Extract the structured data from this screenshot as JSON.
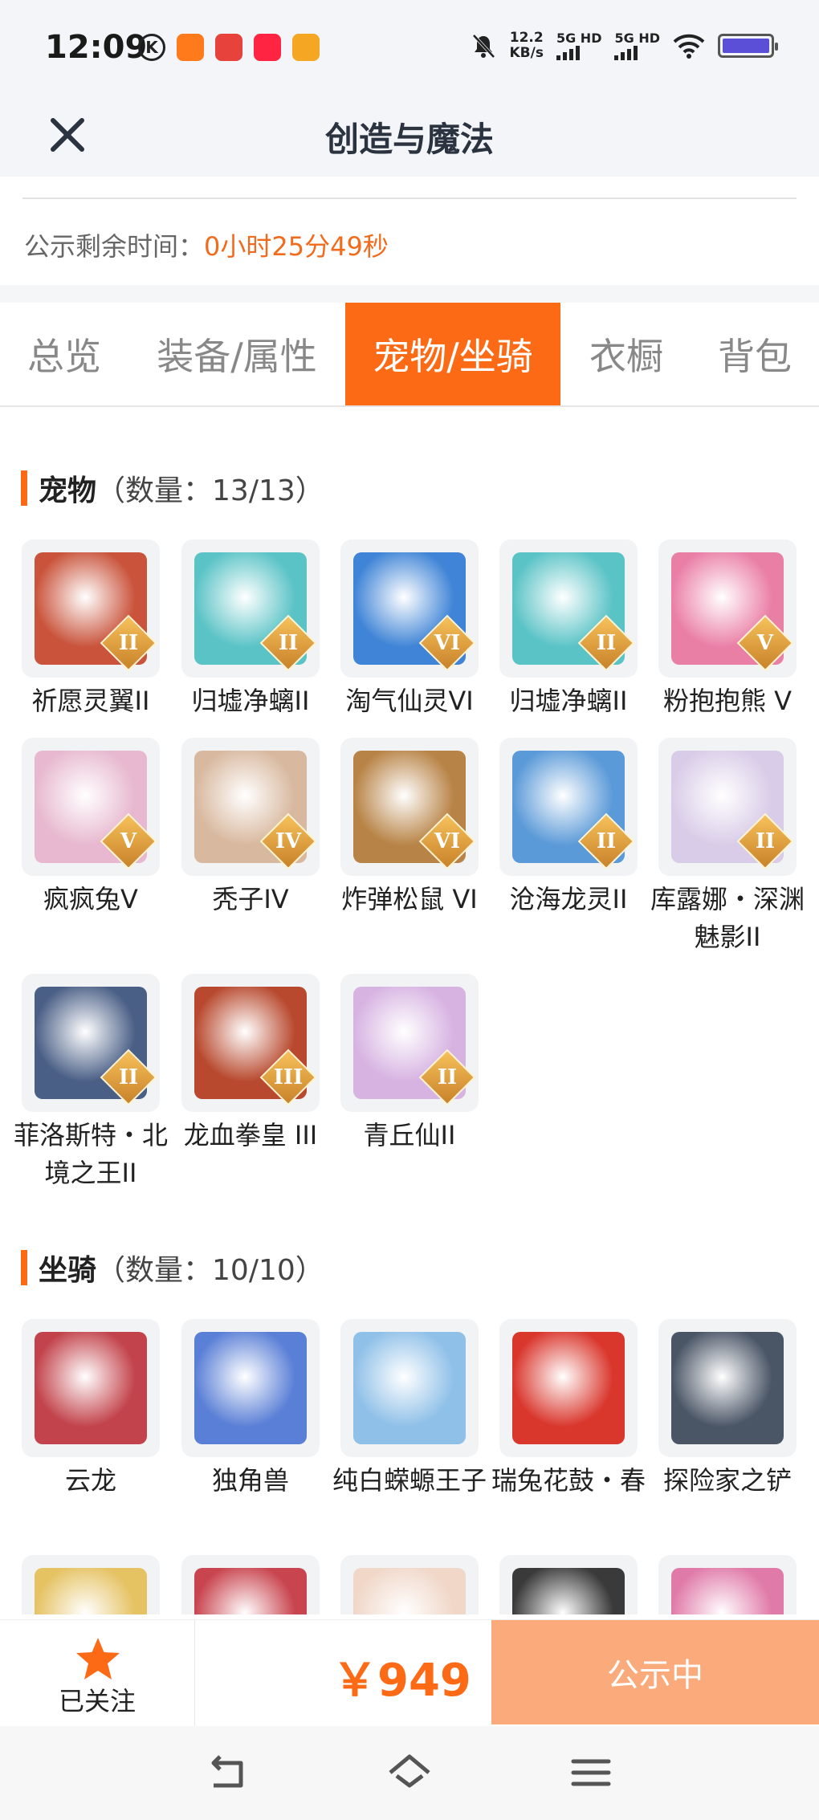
{
  "status_bar": {
    "time": "12:09",
    "k_icon": "K",
    "net_speed_value": "12.2",
    "net_speed_unit": "KB/s",
    "sim1": "5G HD",
    "sim2": "5G HD",
    "app_icons": [
      "kuaishou-icon",
      "app-red-icon",
      "xiaohongshu-icon",
      "app-orange-icon"
    ]
  },
  "header": {
    "title": "创造与魔法",
    "close_icon": "close-icon"
  },
  "countdown": {
    "label": "公示剩余时间：",
    "value": "0小时25分49秒"
  },
  "tabs": [
    {
      "label": "总览",
      "active": false
    },
    {
      "label": "装备/属性",
      "active": false
    },
    {
      "label": "宠物/坐骑",
      "active": true
    },
    {
      "label": "衣橱",
      "active": false
    },
    {
      "label": "背包",
      "active": false
    }
  ],
  "pets_section": {
    "title": "宠物",
    "count": "（数量：13/13）",
    "items": [
      {
        "name": "祈愿灵翼II",
        "badge": "II",
        "color": "#c9533b"
      },
      {
        "name": "归墟净螭II",
        "badge": "II",
        "color": "#5ac3c6"
      },
      {
        "name": "淘气仙灵VI",
        "badge": "VI",
        "color": "#3f84d6"
      },
      {
        "name": "归墟净螭II",
        "badge": "II",
        "color": "#5ac3c6"
      },
      {
        "name": "粉抱抱熊 V",
        "badge": "V",
        "color": "#ea7fa6"
      },
      {
        "name": "疯疯兔V",
        "badge": "V",
        "color": "#e7b8cf"
      },
      {
        "name": "秃子IV",
        "badge": "IV",
        "color": "#d8b89e"
      },
      {
        "name": "炸弹松鼠 VI",
        "badge": "VI",
        "color": "#b88346"
      },
      {
        "name": "沧海龙灵II",
        "badge": "II",
        "color": "#5b9ad8"
      },
      {
        "name": "库露娜・深渊魅影II",
        "badge": "II",
        "color": "#d9cce8"
      },
      {
        "name": "菲洛斯特・北境之王II",
        "badge": "II",
        "color": "#4a5f86"
      },
      {
        "name": "龙血拳皇 III",
        "badge": "III",
        "color": "#b8492e"
      },
      {
        "name": "青丘仙II",
        "badge": "II",
        "color": "#d7b3e2"
      }
    ]
  },
  "mounts_section": {
    "title": "坐骑",
    "count": "（数量：10/10）",
    "items": [
      {
        "name": "云龙",
        "color": "#c2434b"
      },
      {
        "name": "独角兽",
        "color": "#5a7fd6"
      },
      {
        "name": "纯白蝾螈王子",
        "color": "#8fc0e8"
      },
      {
        "name": "瑞兔花鼓・春",
        "color": "#d9362c"
      },
      {
        "name": "探险家之铲",
        "color": "#4a5566"
      },
      {
        "name": "",
        "color": "#e5c262"
      },
      {
        "name": "",
        "color": "#c8444e"
      },
      {
        "name": "",
        "color": "#f0d7c8"
      },
      {
        "name": "",
        "color": "#3a3a3a"
      },
      {
        "name": "",
        "color": "#e07aa8"
      }
    ]
  },
  "action_bar": {
    "follow_label": "已关注",
    "follow_icon": "star-icon",
    "price": "￥949",
    "status_label": "公示中"
  },
  "nav_bar": {
    "icons": [
      "back-icon",
      "home-icon",
      "menu-icon"
    ]
  },
  "colors": {
    "accent": "#fd6a16",
    "status_button": "#fbab7b",
    "background_band": "#f3f5f8"
  }
}
